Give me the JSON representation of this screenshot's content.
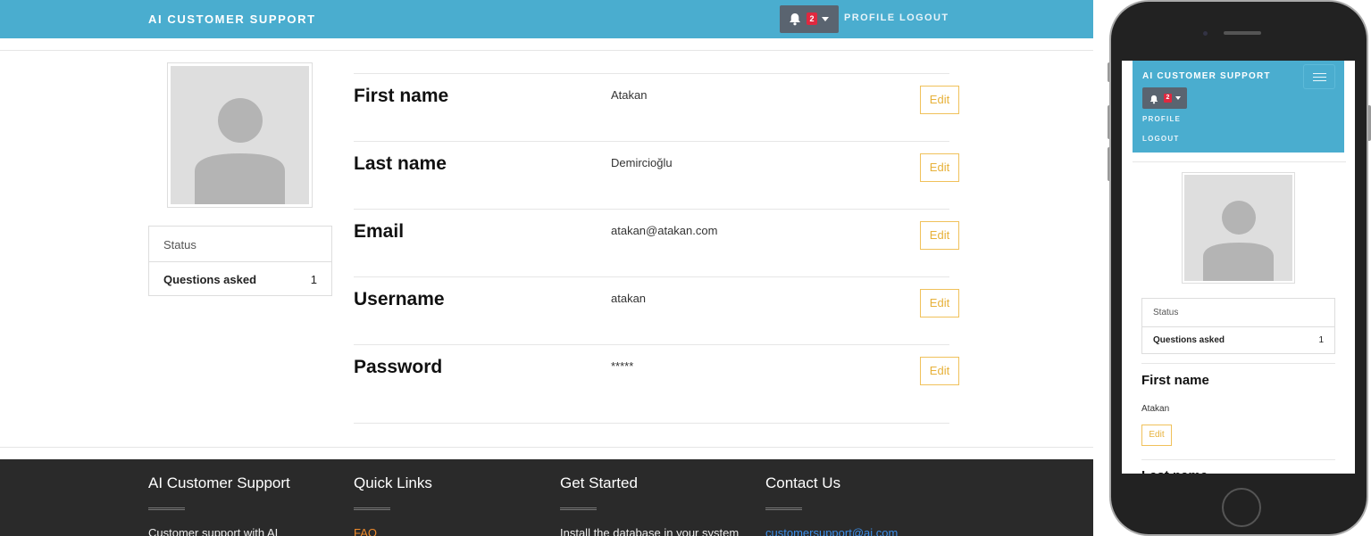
{
  "app": {
    "brand": "AI CUSTOMER SUPPORT",
    "notification_count": "2",
    "nav": {
      "profile": "PROFILE",
      "logout": "LOGOUT"
    }
  },
  "profile": {
    "status_label": "Status",
    "questions_label": "Questions asked",
    "questions_count": "1",
    "fields": [
      {
        "label": "First name",
        "value": "Atakan",
        "action": "Edit"
      },
      {
        "label": "Last name",
        "value": "Demircioğlu",
        "action": "Edit"
      },
      {
        "label": "Email",
        "value": "atakan@atakan.com",
        "action": "Edit"
      },
      {
        "label": "Username",
        "value": "atakan",
        "action": "Edit"
      },
      {
        "label": "Password",
        "value": "*****",
        "action": "Edit"
      }
    ]
  },
  "footer": {
    "columns": [
      {
        "title": "AI Customer Support",
        "text": "Customer support with AI"
      },
      {
        "title": "Quick Links",
        "text": "FAQ"
      },
      {
        "title": "Get Started",
        "text": "Install the database in your system"
      },
      {
        "title": "Contact Us",
        "text": "customersupport@ai.com"
      }
    ]
  },
  "colors": {
    "navbar": "#4aadcf",
    "footer": "#2a2a2a",
    "edit_accent": "#e7b13a",
    "badge": "#e0283f",
    "link_orange": "#ee8a2b",
    "link_blue": "#3c8ee8"
  },
  "icons": {
    "notifications": "bell-icon",
    "dropdown": "caret-down-icon",
    "menu": "hamburger-icon",
    "avatar": "user-placeholder-icon"
  }
}
